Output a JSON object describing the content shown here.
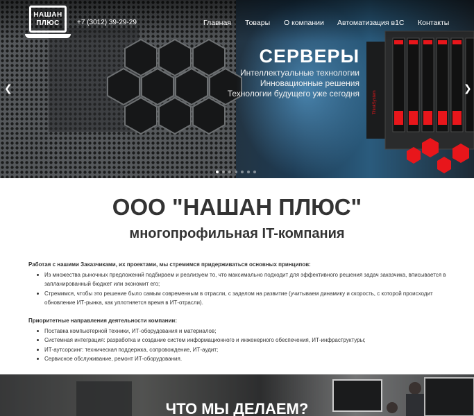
{
  "header": {
    "logo_line1": "НАШАН",
    "logo_line2": "ПЛЮС",
    "phone": "+7 (3012) 39-29-29",
    "nav": [
      "Главная",
      "Товары",
      "О компании",
      "Автоматизация в1С",
      "Контакты"
    ]
  },
  "slider": {
    "title": "СЕРВЕРЫ",
    "lines": [
      "Интеллектуальные технологии",
      "Инновационные решения",
      "Технологии будущего уже сегодня"
    ],
    "server_brand": "ThinkSystem",
    "prev_icon": "chevron-left-icon",
    "next_icon": "chevron-right-icon",
    "active_slide": 1,
    "slide_count": 7
  },
  "main": {
    "company": "ООО \"НАШАН ПЛЮС\"",
    "subtitle": "многопрофильная IT-компания",
    "principles_heading": "Работая с нашими Заказчиками, их проектами, мы стремимся придерживаться основных принципов:",
    "principles": [
      "Из множества рыночных предложений подбираем и реализуем то, что максимально подходит для эффективного решения задач заказчика, вписывается в запланированный бюджет или экономит его;",
      "Стремимся, чтобы это решение было самым современным в отрасли, с заделом на развитие (учитываем динамику и скорость, с которой происходит обновление ИТ-рынка, как уплотняется время в ИТ-отрасли)."
    ],
    "directions_heading": "Приоритетные направления деятельности компании:",
    "directions": [
      "Поставка компьютерной техники, ИТ-оборудования и материалов;",
      "Системная интеграция: разработка и создание систем информационного и инженерного обеспечения, ИТ-инфраструктуры;",
      "ИТ-аутсорсинг: техническая поддержка, сопровождение, ИТ-аудит;",
      "Сервисное обслуживание, ремонт ИТ-оборудования."
    ]
  },
  "bottom": {
    "title": "ЧТО МЫ ДЕЛАЕМ?"
  },
  "colors": {
    "accent_red": "#e8161b",
    "text": "#333333"
  }
}
